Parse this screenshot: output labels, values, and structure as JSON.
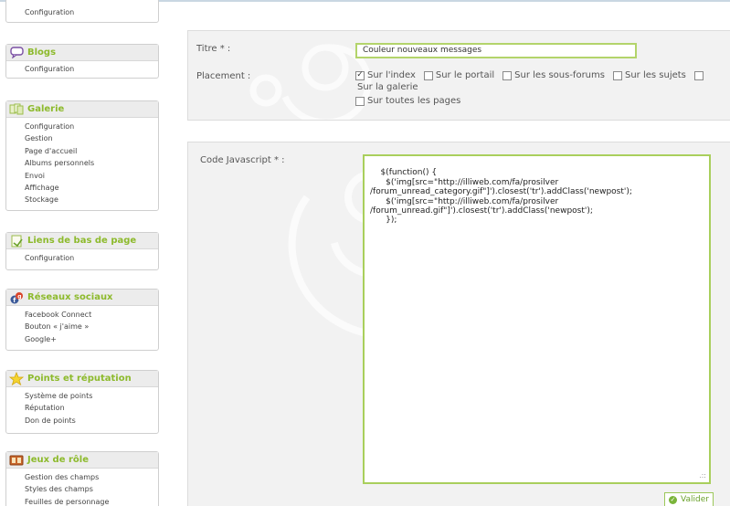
{
  "sidebar": {
    "top_box": {
      "items": [
        "Configuration"
      ]
    },
    "blogs": {
      "title": "Blogs",
      "icon": "speech-bubble-icon",
      "items": [
        "Configuration"
      ]
    },
    "galerie": {
      "title": "Galerie",
      "icon": "gallery-icon",
      "items": [
        "Configuration",
        "Gestion",
        "Page d'accueil",
        "Albums personnels",
        "Envoi",
        "Affichage",
        "Stockage"
      ]
    },
    "liens": {
      "title": "Liens de bas de page",
      "icon": "page-link-icon",
      "items": [
        "Configuration"
      ]
    },
    "reseaux": {
      "title": "Réseaux sociaux",
      "icon": "social-network-icon",
      "items": [
        "Facebook Connect",
        "Bouton « j'aime »",
        "Google+"
      ]
    },
    "points": {
      "title": "Points et réputation",
      "icon": "star-icon",
      "items": [
        "Système de points",
        "Réputation",
        "Don de points"
      ]
    },
    "jeux": {
      "title": "Jeux de rôle",
      "icon": "role-play-icon",
      "items": [
        "Gestion des champs",
        "Styles des champs",
        "Feuilles de personnage"
      ]
    }
  },
  "form": {
    "title_label": "Titre * :",
    "title_value": "Couleur nouveaux messages",
    "placement_label": "Placement :",
    "placements": [
      {
        "label": "Sur l'index",
        "checked": true
      },
      {
        "label": "Sur le portail",
        "checked": false
      },
      {
        "label": "Sur les sous-forums",
        "checked": false
      },
      {
        "label": "Sur les sujets",
        "checked": false
      }
    ],
    "placement_galerie": {
      "label": "Sur la galerie",
      "checked": false
    },
    "placement_all": {
      "label": "Sur toutes les pages",
      "checked": false
    },
    "code_label": "Code Javascript * :",
    "code_value": "$(function() {\n      $('img[src=\"http://illiweb.com/fa/prosilver\n/forum_unread_category.gif\"]').closest('tr').addClass('newpost');\n      $('img[src=\"http://illiweb.com/fa/prosilver\n/forum_unread.gif\"]').closest('tr').addClass('newpost');\n      });",
    "submit_label": "Valider"
  },
  "colors": {
    "accent_green": "#8dba2c",
    "input_border": "#b3d46b",
    "panel_bg": "#f2f2f2"
  }
}
